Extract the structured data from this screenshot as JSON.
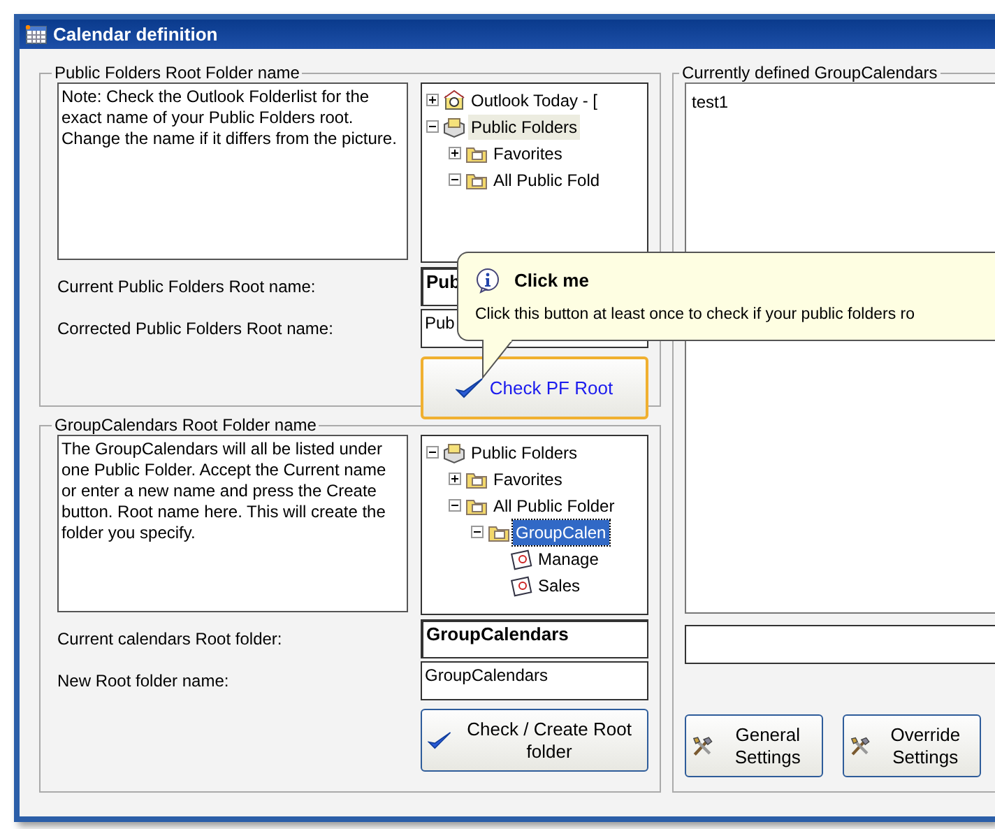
{
  "window": {
    "title": "Calendar definition"
  },
  "public_folders_group": {
    "legend": "Public Folders Root Folder name",
    "note": "Note: Check the Outlook Folderlist for the exact name of your Public Folders root. Change the name if it differs from the picture.",
    "tree": [
      {
        "label": "Outlook Today - [",
        "kind": "today",
        "expanded": false,
        "selected": false
      },
      {
        "label": "Public Folders",
        "kind": "store",
        "expanded": true,
        "selected": true,
        "children": [
          {
            "label": "Favorites",
            "kind": "folder",
            "expanded": false,
            "selected": false
          },
          {
            "label": "All Public Fold",
            "kind": "folder",
            "expanded": true,
            "selected": false
          }
        ]
      }
    ],
    "fields": [
      {
        "label": "Current Public Folders Root name:",
        "value": "Pub",
        "bold": true
      },
      {
        "label": "Corrected Public Folders Root name:",
        "value": "Pub",
        "bold": false
      }
    ],
    "button": {
      "label": "Check PF Root",
      "focused": true
    }
  },
  "group_calendars_group": {
    "legend": "GroupCalendars Root Folder name",
    "note": "The GroupCalendars will all be listed under one Public Folder. Accept the Current name or enter a new name and press the Create button. Root name here. This will create the folder you specify.",
    "tree": [
      {
        "label": "Public Folders",
        "kind": "store",
        "expanded": true,
        "selected": false,
        "children": [
          {
            "label": "Favorites",
            "kind": "folder",
            "expanded": false,
            "selected": false
          },
          {
            "label": "All Public Folder",
            "kind": "folder",
            "expanded": true,
            "selected": false,
            "children": [
              {
                "label": "GroupCalen",
                "kind": "folder",
                "expanded": true,
                "selected": true,
                "children": [
                  {
                    "label": "Manage",
                    "kind": "calendar",
                    "selected": false
                  },
                  {
                    "label": "Sales",
                    "kind": "calendar",
                    "selected": false
                  }
                ]
              }
            ]
          }
        ]
      }
    ],
    "fields": [
      {
        "label": "Current calendars Root folder:",
        "value": "GroupCalendars",
        "bold": true
      },
      {
        "label": "New Root folder name:",
        "value": "GroupCalendars",
        "bold": false
      }
    ],
    "button": {
      "label": "Check / Create Root folder",
      "focused": false
    }
  },
  "calendars_group": {
    "legend": "Currently defined GroupCalendars",
    "items": [
      "test1"
    ],
    "buttons": [
      {
        "label": "General Settings",
        "focused": false
      },
      {
        "label": "Override Settings",
        "focused": false
      }
    ]
  },
  "tooltip": {
    "title": "Click me",
    "text": "Click this button at least once to check if your public folders ro"
  }
}
